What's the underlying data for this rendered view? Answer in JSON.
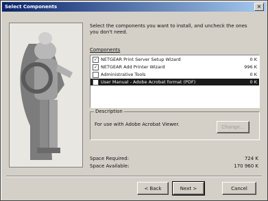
{
  "window": {
    "title": "Select Components",
    "close_glyph": "×"
  },
  "instruction": "Select the components you want to install, and uncheck the ones you don't need.",
  "components_label": "Components",
  "components": [
    {
      "label": "NETGEAR Print Server Setup Wizard",
      "size": "0 K",
      "checked": true,
      "selected": false
    },
    {
      "label": "NETGEAR Add Printer Wizard",
      "size": "996 K",
      "checked": true,
      "selected": false
    },
    {
      "label": "Administrative Tools",
      "size": "0 K",
      "checked": false,
      "selected": false
    },
    {
      "label": "User Manual - Adobe Acrobat format (PDF)",
      "size": "0 K",
      "checked": false,
      "selected": true
    }
  ],
  "description": {
    "label": "Description",
    "text": "For use with Adobe Acrobat Viewer.",
    "change_button": "Change..."
  },
  "space": {
    "required_label": "Space Required:",
    "required_value": "724 K",
    "available_label": "Space Available:",
    "available_value": "170 960 K"
  },
  "buttons": {
    "back": "< Back",
    "next": "Next >",
    "cancel": "Cancel"
  },
  "colors": {
    "title_start": "#0a246a",
    "title_end": "#a6caf0",
    "face": "#d4d0c8",
    "selection": "#1a1a1a"
  }
}
